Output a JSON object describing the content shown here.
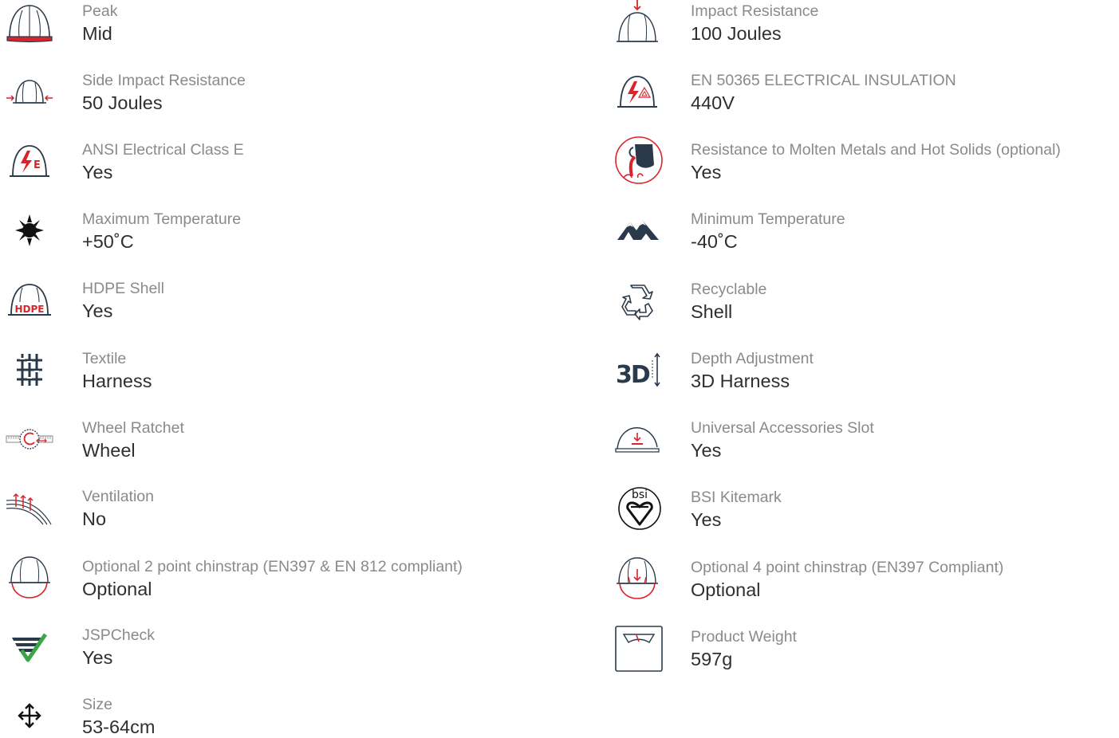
{
  "left": [
    {
      "icon": "helmet-peak-icon",
      "label": "Peak",
      "value": "Mid"
    },
    {
      "icon": "side-impact-icon",
      "label": "Side Impact Resistance",
      "value": "50 Joules"
    },
    {
      "icon": "ansi-electrical-icon",
      "label": "ANSI Electrical Class E",
      "value": "Yes"
    },
    {
      "icon": "sun-icon",
      "label": "Maximum Temperature",
      "value": "+50˚C"
    },
    {
      "icon": "hdpe-shell-icon",
      "label": "HDPE Shell",
      "value": "Yes"
    },
    {
      "icon": "textile-grid-icon",
      "label": "Textile",
      "value": "Harness"
    },
    {
      "icon": "wheel-ratchet-icon",
      "label": "Wheel Ratchet",
      "value": "Wheel"
    },
    {
      "icon": "ventilation-icon",
      "label": "Ventilation",
      "value": "No"
    },
    {
      "icon": "chinstrap-2-point-icon",
      "label": "Optional 2 point chinstrap (EN397 & EN 812 compliant)",
      "value": "Optional"
    },
    {
      "icon": "jspcheck-icon",
      "label": "JSPCheck",
      "value": "Yes"
    },
    {
      "icon": "size-arrows-icon",
      "label": "Size",
      "value": "53-64cm"
    }
  ],
  "right": [
    {
      "icon": "impact-resistance-icon",
      "label": "Impact Resistance",
      "value": "100 Joules"
    },
    {
      "icon": "electrical-insulation-icon",
      "label": "EN 50365 ELECTRICAL INSULATION",
      "value": "440V"
    },
    {
      "icon": "molten-metal-icon",
      "label": "Resistance to Molten Metals and Hot Solids (optional)",
      "value": "Yes"
    },
    {
      "icon": "mountains-icon",
      "label": "Minimum Temperature",
      "value": "-40˚C"
    },
    {
      "icon": "recycle-icon",
      "label": "Recyclable",
      "value": "Shell"
    },
    {
      "icon": "depth-3d-icon",
      "label": "Depth Adjustment",
      "value": "3D Harness"
    },
    {
      "icon": "accessory-slot-icon",
      "label": "Universal Accessories Slot",
      "value": "Yes"
    },
    {
      "icon": "bsi-kitemark-icon",
      "label": "BSI Kitemark",
      "value": "Yes"
    },
    {
      "icon": "chinstrap-4-point-icon",
      "label": "Optional 4 point chinstrap (EN397 Compliant)",
      "value": "Optional"
    },
    {
      "icon": "scale-icon",
      "label": "Product Weight",
      "value": "597g"
    }
  ],
  "icon_text": {
    "hdpe": "HDPE",
    "ansi_e": "E",
    "bsi": "bsi",
    "three_d": "3D"
  },
  "colors": {
    "accent_red": "#d9242b",
    "navy": "#2b3a4a",
    "label_gray": "#8a8a8a",
    "value_dark": "#2f2f2f",
    "check_green": "#3aa648"
  }
}
